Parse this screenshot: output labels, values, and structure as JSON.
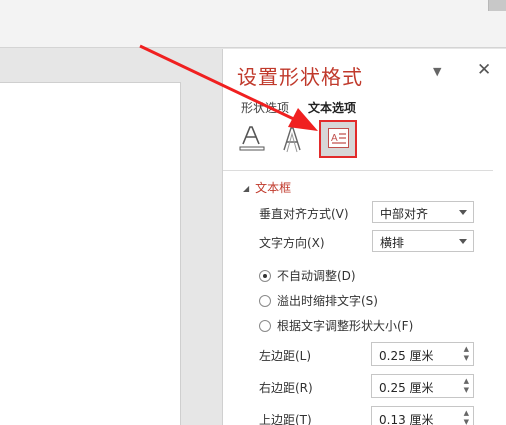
{
  "pane": {
    "title": "设置形状格式",
    "menu_icon": "▼",
    "close_icon": "✕",
    "tabs": {
      "shape_options": "形状选项",
      "text_options": "文本选项"
    },
    "icons": [
      "text-fill-outline-icon",
      "text-effects-icon",
      "textbox-icon"
    ],
    "section": {
      "title": "文本框",
      "expanded": true
    },
    "vertical_align": {
      "label": "垂直对齐方式(V)",
      "value": "中部对齐"
    },
    "text_direction": {
      "label": "文字方向(X)",
      "value": "横排"
    },
    "autofit": [
      {
        "label": "不自动调整(D)",
        "selected": true
      },
      {
        "label": "溢出时缩排文字(S)",
        "selected": false
      },
      {
        "label": "根据文字调整形状大小(F)",
        "selected": false
      }
    ],
    "margins": [
      {
        "label": "左边距(L)",
        "value": "0.25 厘米"
      },
      {
        "label": "右边距(R)",
        "value": "0.25 厘米"
      },
      {
        "label": "上边距(T)",
        "value": "0.13 厘米"
      }
    ]
  },
  "colors": {
    "accent": "#c0392b",
    "highlight": "#e22b2b",
    "annotation_arrow": "#f02020"
  }
}
